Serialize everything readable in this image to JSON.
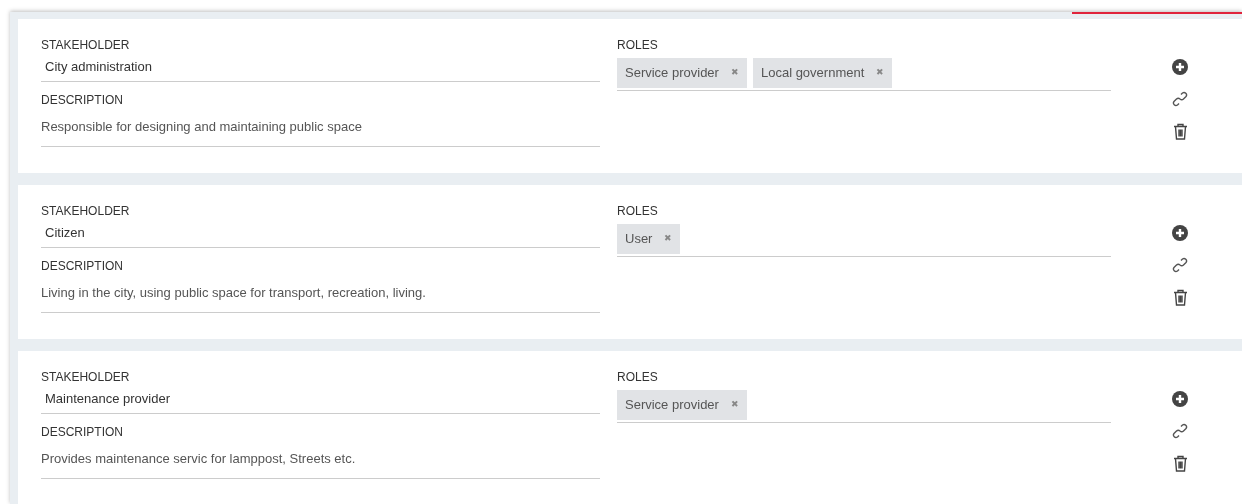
{
  "stakeholders": [
    {
      "stakeholder_label": "STAKEHOLDER",
      "stakeholder": "City administration",
      "description_label": "DESCRIPTION",
      "description": "Responsible for designing and maintaining public space",
      "roles_label": "ROLES",
      "roles": [
        "Service provider",
        "Local government"
      ],
      "remove_mark": "✖"
    },
    {
      "stakeholder_label": "STAKEHOLDER",
      "stakeholder": "Citizen",
      "description_label": "DESCRIPTION",
      "description": "Living in the city, using public space for transport, recreation, living.",
      "roles_label": "ROLES",
      "roles": [
        "User"
      ],
      "remove_mark": "✖"
    },
    {
      "stakeholder_label": "STAKEHOLDER",
      "stakeholder": "Maintenance provider",
      "description_label": "DESCRIPTION",
      "description": "Provides maintenance servic for lamppost, Streets etc.",
      "roles_label": "ROLES",
      "roles": [
        "Service provider"
      ],
      "remove_mark": "✖"
    }
  ]
}
